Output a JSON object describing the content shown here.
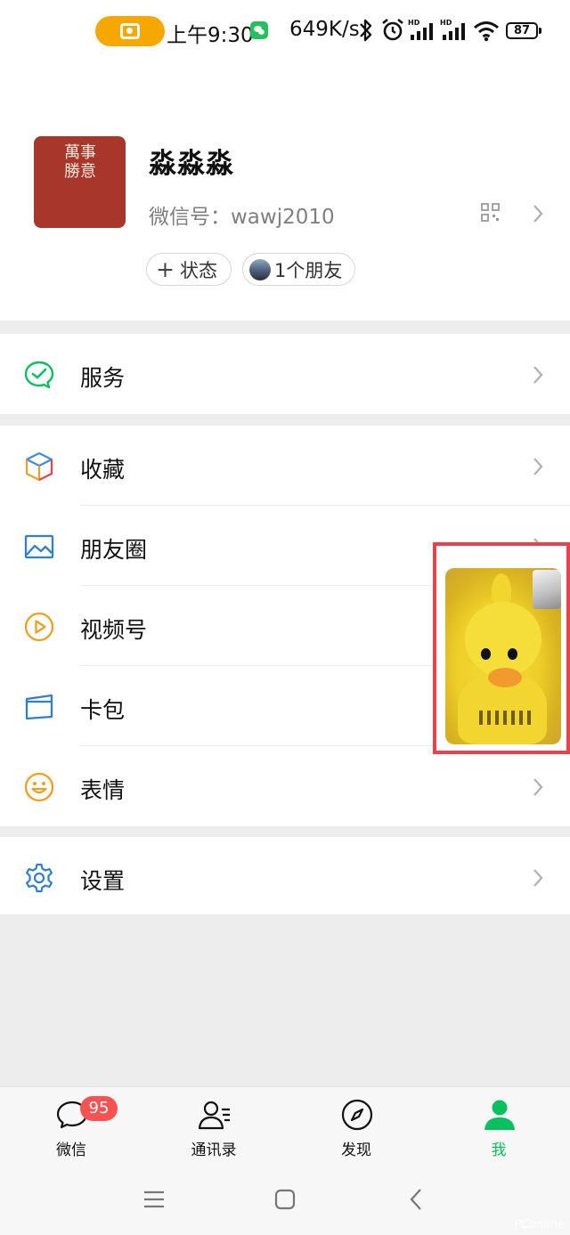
{
  "status_bar": {
    "time": "上午9:30",
    "network_speed": "649K/s",
    "battery": "87",
    "icons": [
      "camera-icon",
      "wechat-notification-icon",
      "bluetooth-icon",
      "alarm-icon",
      "hd-signal-icon",
      "hd-signal-icon",
      "wifi-icon",
      "battery-icon"
    ]
  },
  "profile": {
    "avatar_text": "萬事勝意",
    "nickname": "淼淼淼",
    "wechat_id": "微信号：wawj2010",
    "status_chip": "状态",
    "friends_chip": "1个朋友"
  },
  "menu": {
    "service": "服务",
    "favorites": "收藏",
    "moments": "朋友圈",
    "channels": "视频号",
    "cards": "卡包",
    "stickers": "表情",
    "settings": "设置"
  },
  "tabbar": {
    "chats": "微信",
    "chats_badge": "95",
    "contacts": "通讯录",
    "discover": "发现",
    "me": "我",
    "active": "me"
  },
  "colors": {
    "accent_green": "#07c160",
    "badge_red": "#fa5151",
    "highlight_border": "#e8434c",
    "camera_pill": "#f6a800"
  },
  "watermark": "PConline"
}
